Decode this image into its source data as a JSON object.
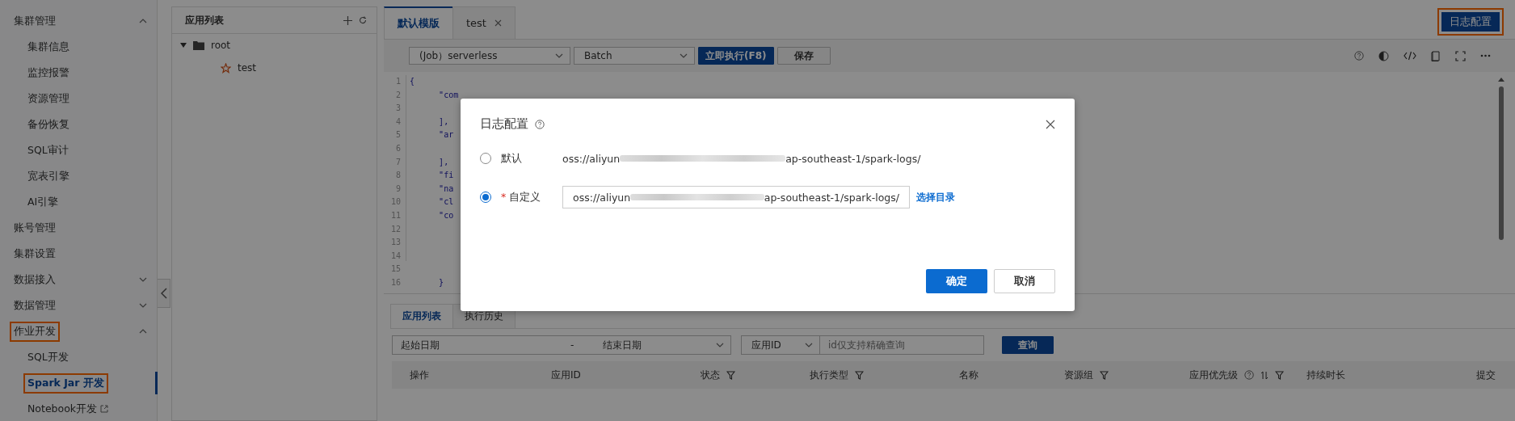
{
  "sidebar": {
    "groups": [
      {
        "label": "集群管理",
        "kind": "group",
        "expanded": true,
        "highlighted": false,
        "children": [
          {
            "label": "集群信息",
            "selected": false,
            "highlighted": false,
            "external": false
          },
          {
            "label": "监控报警",
            "selected": false,
            "highlighted": false,
            "external": false
          },
          {
            "label": "资源管理",
            "selected": false,
            "highlighted": false,
            "external": false
          },
          {
            "label": "备份恢复",
            "selected": false,
            "highlighted": false,
            "external": false
          },
          {
            "label": "SQL审计",
            "selected": false,
            "highlighted": false,
            "external": false
          },
          {
            "label": "宽表引擎",
            "selected": false,
            "highlighted": false,
            "external": false
          },
          {
            "label": "AI引擎",
            "selected": false,
            "highlighted": false,
            "external": false
          }
        ]
      },
      {
        "label": "账号管理",
        "kind": "link",
        "highlighted": false
      },
      {
        "label": "集群设置",
        "kind": "link",
        "highlighted": false
      },
      {
        "label": "数据接入",
        "kind": "group",
        "expanded": false,
        "highlighted": false
      },
      {
        "label": "数据管理",
        "kind": "group",
        "expanded": false,
        "highlighted": false
      },
      {
        "label": "作业开发",
        "kind": "group",
        "expanded": true,
        "highlighted": true,
        "children": [
          {
            "label": "SQL开发",
            "selected": false,
            "highlighted": false,
            "external": false
          },
          {
            "label": "Spark Jar 开发",
            "selected": true,
            "highlighted": true,
            "external": false
          },
          {
            "label": "Notebook开发",
            "selected": false,
            "highlighted": false,
            "external": true
          }
        ]
      }
    ]
  },
  "tree": {
    "title": "应用列表",
    "nodes": [
      {
        "label": "root",
        "kind": "folder",
        "expanded": true,
        "children": [
          {
            "label": "test",
            "kind": "app"
          }
        ]
      }
    ]
  },
  "editor_tabs": [
    {
      "label": "默认模版",
      "selected": true,
      "closable": false
    },
    {
      "label": "test",
      "selected": false,
      "closable": true
    }
  ],
  "log_config_button": {
    "label": "日志配置",
    "highlighted": true
  },
  "toolbar": {
    "job_select": "(Job）serverless",
    "type_select": "Batch",
    "run_button": "立即执行(F8)",
    "save_button": "保存"
  },
  "code_lines": [
    {
      "number": "1",
      "text": "{"
    },
    {
      "number": "2",
      "text": "      \"com"
    },
    {
      "number": "3"
    },
    {
      "number": "4",
      "text": "      ],"
    },
    {
      "number": "5",
      "text": "      \"ar"
    },
    {
      "number": "6"
    },
    {
      "number": "7",
      "text": "      ],"
    },
    {
      "number": "8",
      "text": "      \"fi"
    },
    {
      "number": "9",
      "text": "      \"na"
    },
    {
      "number": "10",
      "text": "      \"cl"
    },
    {
      "number": "11",
      "text": "      \"co"
    },
    {
      "number": "12"
    },
    {
      "number": "13"
    },
    {
      "number": "14"
    },
    {
      "number": "15"
    },
    {
      "number": "16",
      "text": "      }"
    }
  ],
  "bottom_tabs": [
    {
      "label": "应用列表",
      "selected": true
    },
    {
      "label": "执行历史",
      "selected": false
    }
  ],
  "filters": {
    "start_date": "起始日期",
    "separator": "-",
    "end_date": "结束日期",
    "id_select": "应用ID",
    "id_placeholder": "id仅支持精确查询",
    "query_button": "查询"
  },
  "table": {
    "columns": [
      {
        "label": "操作",
        "filter": false,
        "help": false,
        "sort": false
      },
      {
        "label": "应用ID",
        "filter": false,
        "help": false,
        "sort": false
      },
      {
        "label": "状态",
        "filter": true,
        "help": false,
        "sort": false
      },
      {
        "label": "执行类型",
        "filter": true,
        "help": false,
        "sort": false
      },
      {
        "label": "名称",
        "filter": false,
        "help": false,
        "sort": false
      },
      {
        "label": "资源组",
        "filter": true,
        "help": false,
        "sort": false
      },
      {
        "label": "应用优先级",
        "filter": true,
        "help": true,
        "sort": true
      },
      {
        "label": "持续时长",
        "filter": false,
        "help": false,
        "sort": false
      },
      {
        "label": "提交",
        "filter": false,
        "help": false,
        "sort": false
      }
    ]
  },
  "dialog": {
    "title": "日志配置",
    "options": [
      {
        "label": "默认",
        "selected": false,
        "kind": "text",
        "path_prefix": "oss://aliyun",
        "path_suffix": "ap-southeast-1/spark-logs/"
      },
      {
        "label": "自定义",
        "selected": true,
        "required_mark": "*",
        "kind": "field",
        "path_prefix": "oss://aliyun",
        "path_suffix": "ap-southeast-1/spark-logs/",
        "link": "选择目录"
      }
    ],
    "ok_button": "确定",
    "cancel_button": "取消"
  }
}
